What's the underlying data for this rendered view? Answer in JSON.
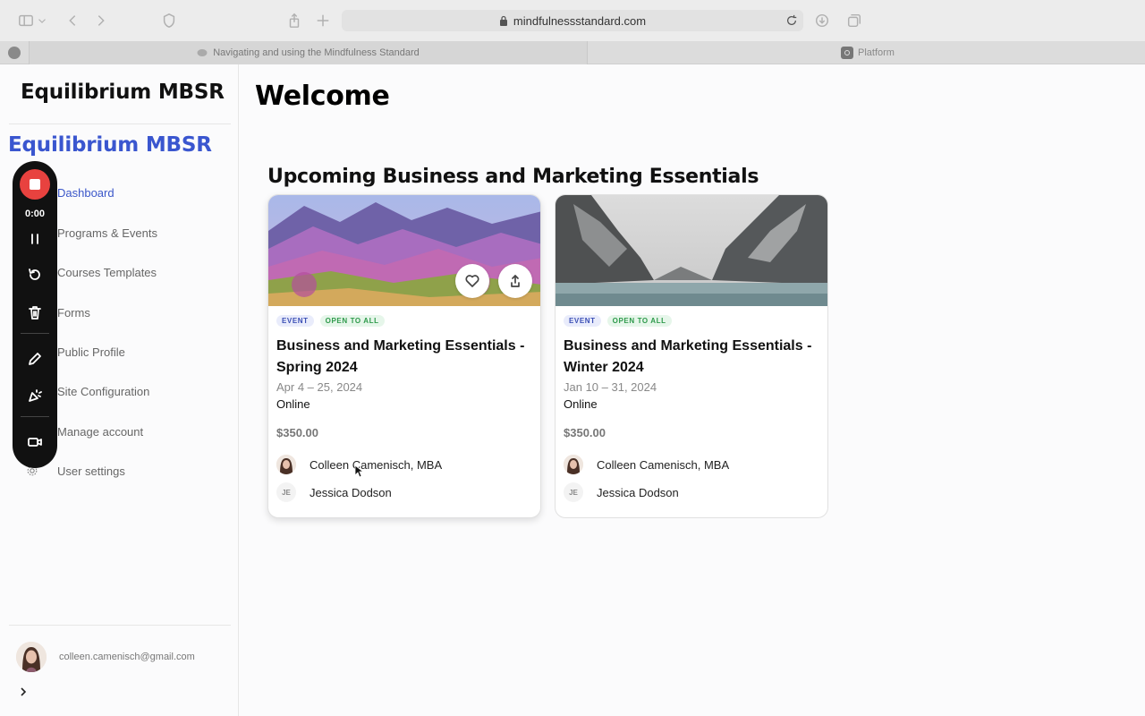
{
  "browser": {
    "url": "mindfulnessstandard.com",
    "active_tab_title": "Navigating and using the Mindfulness Standard",
    "other_tab_title": "Platform"
  },
  "sidebar": {
    "brand": "Equilibrium MBSR",
    "brand_secondary": "Equilibrium MBSR",
    "items": [
      {
        "label": "Dashboard",
        "active": true
      },
      {
        "label": "Programs & Events"
      },
      {
        "label": "Courses Templates"
      },
      {
        "label": "Forms"
      },
      {
        "label": "Public Profile"
      },
      {
        "label": "Site Configuration"
      },
      {
        "label": "Manage account"
      },
      {
        "label": "User settings",
        "icon": "gear-icon"
      }
    ],
    "user_email": "colleen.camenisch@gmail.com"
  },
  "recorder": {
    "time": "0:00",
    "icons": [
      "stop-icon",
      "pause-icon",
      "restart-icon",
      "trash-icon",
      "pencil-icon",
      "effects-icon",
      "camera-icon"
    ]
  },
  "main": {
    "heading": "Welcome",
    "section_title": "Upcoming Business and Marketing Essentials",
    "cards": [
      {
        "badge_type": "EVENT",
        "badge_access": "OPEN TO ALL",
        "title": "Business and Marketing Essentials - Spring 2024",
        "date": "Apr 4 – 25, 2024",
        "location": "Online",
        "price": "$350.00",
        "people": [
          {
            "name": "Colleen Camenisch, MBA",
            "avatar": "photo"
          },
          {
            "name": "Jessica Dodson",
            "initials": "JE"
          }
        ]
      },
      {
        "badge_type": "EVENT",
        "badge_access": "OPEN TO ALL",
        "title": "Business and Marketing Essentials - Winter 2024",
        "date": "Jan 10 – 31, 2024",
        "location": "Online",
        "price": "$350.00",
        "people": [
          {
            "name": "Colleen Camenisch, MBA",
            "avatar": "photo"
          },
          {
            "name": "Jessica Dodson",
            "initials": "JE"
          }
        ]
      }
    ]
  },
  "colors": {
    "accent": "#3a56cf",
    "recorder_stop": "#e8423f",
    "badge_event": "#3b4fb5",
    "badge_open": "#2e9a4b"
  }
}
